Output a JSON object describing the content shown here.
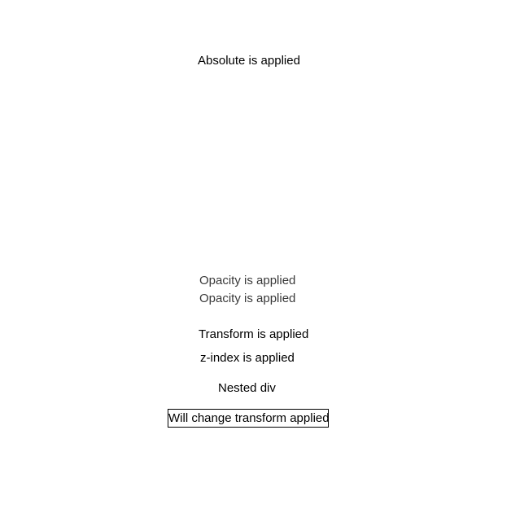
{
  "labels": {
    "absolute": "Absolute is applied",
    "opacity_1": "Opacity is applied",
    "opacity_2": "Opacity is applied",
    "transform": "Transform is applied",
    "z_index": "z-index is applied",
    "nested": "Nested div",
    "will_change": "Will change transform applied"
  }
}
